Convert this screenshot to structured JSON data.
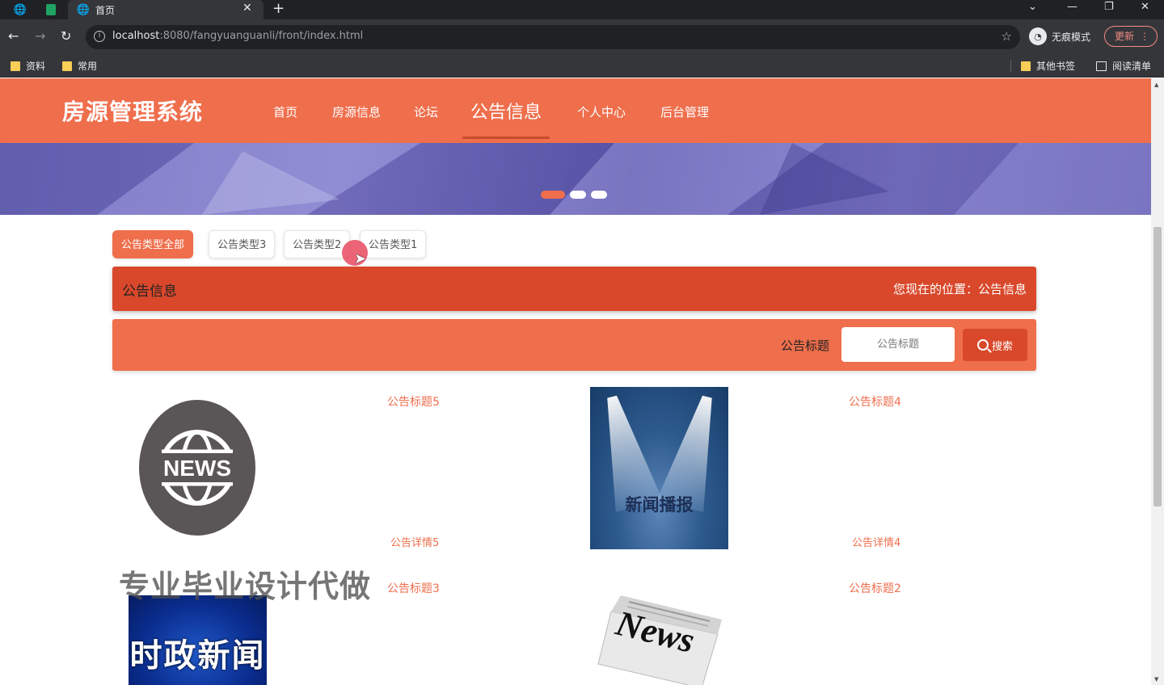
{
  "browser": {
    "tab_title": "首页",
    "url_host": "localhost",
    "url_rest": ":8080/fangyuanguanli/front/index.html",
    "incognito_label": "无痕模式",
    "update_label": "更新",
    "bookmarks": [
      "资料",
      "常用"
    ],
    "other_bookmarks": "其他书签",
    "reading_list": "阅读清单"
  },
  "site": {
    "title": "房源管理系统",
    "nav": [
      "首页",
      "房源信息",
      "论坛",
      "公告信息",
      "个人中心",
      "后台管理"
    ],
    "active_nav": "公告信息"
  },
  "filters": {
    "items": [
      "公告类型全部",
      "公告类型3",
      "公告类型2",
      "公告类型1"
    ],
    "active": "公告类型全部"
  },
  "section": {
    "title": "公告信息",
    "breadcrumb": "您现在的位置：公告信息"
  },
  "search": {
    "label": "公告标题",
    "placeholder": "公告标题",
    "button": "搜索"
  },
  "news": [
    {
      "title": "公告标题5",
      "detail": "公告详情5",
      "image": "NEWS"
    },
    {
      "title": "公告标题4",
      "detail": "公告详情4",
      "image": "新闻播报"
    },
    {
      "title": "公告标题3",
      "detail": "",
      "image": "时政新闻"
    },
    {
      "title": "公告标题2",
      "detail": "",
      "image": "News"
    }
  ],
  "watermark": "专业毕业设计代做",
  "colors": {
    "primary": "#ef6e4c",
    "dark_primary": "#d9482b",
    "chrome_bg": "#35363a"
  }
}
